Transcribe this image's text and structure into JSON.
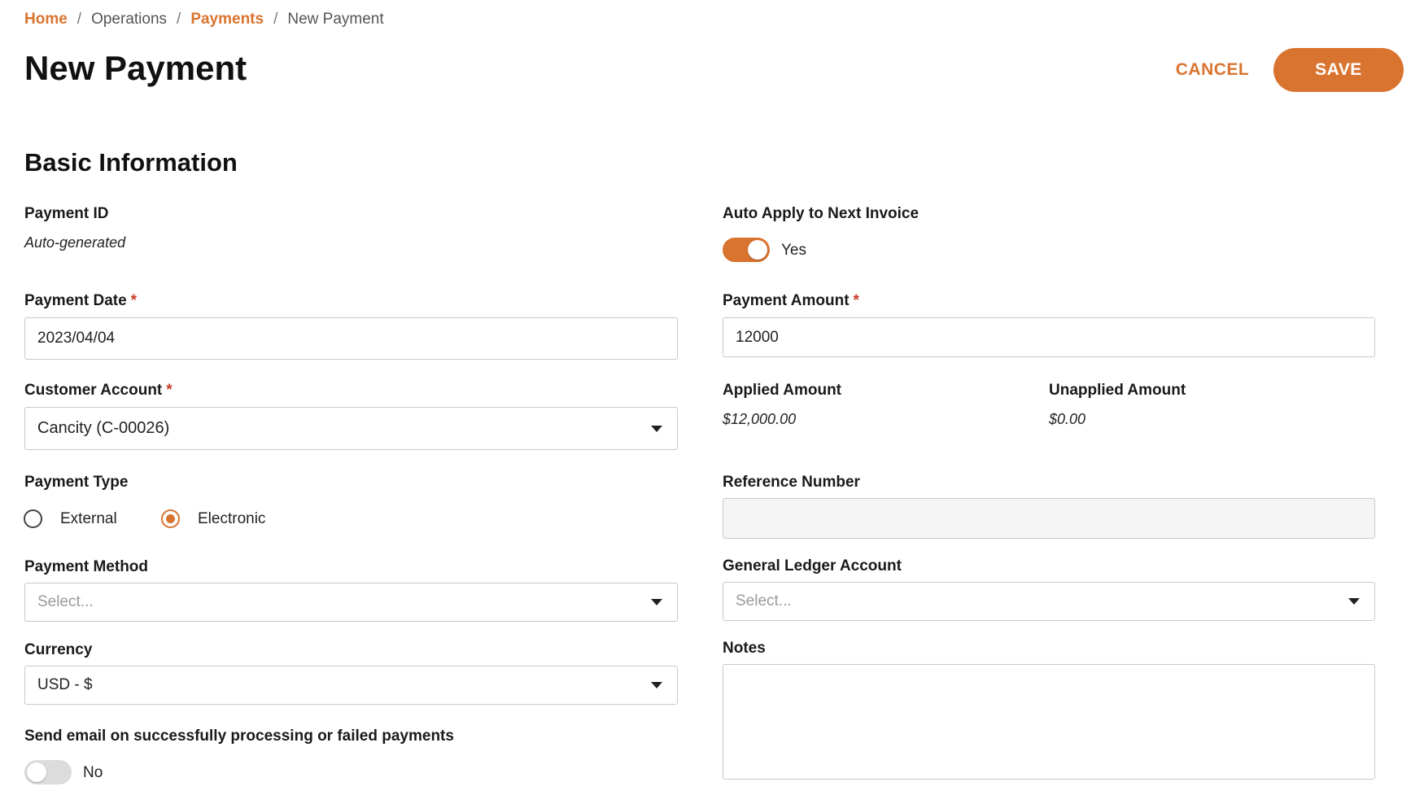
{
  "breadcrumb": {
    "items": [
      "Home",
      "Operations",
      "Payments",
      "New Payment"
    ],
    "separator": "/"
  },
  "header": {
    "title": "New Payment",
    "cancel_label": "CANCEL",
    "save_label": "SAVE"
  },
  "section": {
    "title": "Basic Information"
  },
  "form": {
    "payment_id": {
      "label": "Payment ID",
      "value": "Auto-generated"
    },
    "auto_apply": {
      "label": "Auto Apply to Next Invoice",
      "state_text": "Yes",
      "enabled": true
    },
    "payment_date": {
      "label": "Payment Date",
      "required_mark": "*",
      "value": "2023/04/04"
    },
    "payment_amount": {
      "label": "Payment Amount",
      "required_mark": "*",
      "value": "12000"
    },
    "customer_account": {
      "label": "Customer Account",
      "required_mark": "*",
      "value": "Cancity (C-00026)"
    },
    "applied_amount": {
      "label": "Applied Amount",
      "value": "$12,000.00"
    },
    "unapplied_amount": {
      "label": "Unapplied Amount",
      "value": "$0.00"
    },
    "payment_type": {
      "label": "Payment Type",
      "options": [
        "External",
        "Electronic"
      ],
      "selected": "Electronic"
    },
    "reference_number": {
      "label": "Reference Number",
      "value": ""
    },
    "payment_method": {
      "label": "Payment Method",
      "placeholder": "Select..."
    },
    "general_ledger_account": {
      "label": "General Ledger Account",
      "placeholder": "Select..."
    },
    "currency": {
      "label": "Currency",
      "value": "USD - $"
    },
    "notes": {
      "label": "Notes",
      "value": ""
    },
    "send_email": {
      "label": "Send email on successfully processing or failed payments",
      "state_text": "No",
      "enabled": false
    }
  },
  "colors": {
    "accent": "#d97430",
    "required": "#c73b2b",
    "toggle_off": "#dcdcdc"
  },
  "icons": [
    "chevron-down-icon"
  ]
}
